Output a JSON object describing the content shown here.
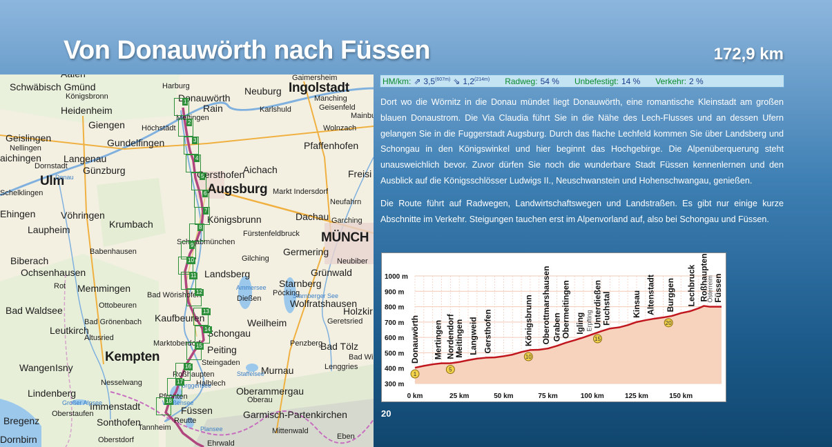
{
  "header": {
    "title": "Von Donauwörth nach Füssen",
    "distance": "172,9 km"
  },
  "infobar": {
    "hm_label": "HM/km:",
    "up_value": "3,5",
    "up_total": "(607m)",
    "down_value": "1,2",
    "down_total": "(214m)",
    "radweg_label": "Radweg:",
    "radweg_value": "54 %",
    "unbefestigt_label": "Unbefestigt:",
    "unbefestigt_value": "14 %",
    "verkehr_label": "Verkehr:",
    "verkehr_value": "2 %"
  },
  "text": {
    "paragraph1": "Dort wo die Wörnitz in die Donau mündet liegt Donauwörth, eine romantische Kleinstadt am großen blauen Donaustrom. Die Via Claudia führt Sie in die Nähe des Lech-Flusses und an dessen Ufern gelangen Sie in die Fuggerstadt Augsburg. Durch das flache Lechfeld kommen Sie über Landsberg und Schongau in den Königswinkel und hier beginnt das Hochgebirge. Die Alpenüberquerung steht unausweichlich bevor. Zuvor dürfen Sie noch die wunderbare Stadt Füssen kennenlernen und den Ausblick auf die Königsschlösser Ludwigs II., Neuschwanstein und Hohenschwangau, genießen.",
    "paragraph2": "Die Route führt auf Radwegen, Landwirtschaftswegen und Landstraßen. Es gibt nur einige kurze Abschnitte im Verkehr. Steigungen tauchen erst im Alpenvorland auf, also bei Schongau und Füssen."
  },
  "page_number": "20",
  "map": {
    "places": [
      {
        "name": "Aalen",
        "cls": "p-mid"
      },
      {
        "name": "Schwäbisch Gmünd",
        "cls": "p-mid"
      },
      {
        "name": "Königsbronn",
        "cls": "p-sm"
      },
      {
        "name": "Heidenheim",
        "cls": "p-mid"
      },
      {
        "name": "Giengen",
        "cls": "p-mid"
      },
      {
        "name": "Höchstädt",
        "cls": "p-sm"
      },
      {
        "name": "Geislingen",
        "cls": "p-mid"
      },
      {
        "name": "Nellingen",
        "cls": "p-sm"
      },
      {
        "name": "aichingen",
        "cls": "p-mid"
      },
      {
        "name": "Gundelfingen",
        "cls": "p-mid"
      },
      {
        "name": "Langenau",
        "cls": "p-mid"
      },
      {
        "name": "Günzburg",
        "cls": "p-mid"
      },
      {
        "name": "Dornstadt",
        "cls": "p-sm"
      },
      {
        "name": "Ulm",
        "cls": "p-big"
      },
      {
        "name": "Schelklingen",
        "cls": "p-sm"
      },
      {
        "name": "Ehingen",
        "cls": "p-mid"
      },
      {
        "name": "Vöhringen",
        "cls": "p-mid"
      },
      {
        "name": "Laupheim",
        "cls": "p-mid"
      },
      {
        "name": "Krumbach",
        "cls": "p-mid"
      },
      {
        "name": "Babenhausen",
        "cls": "p-sm"
      },
      {
        "name": "Biberach",
        "cls": "p-mid"
      },
      {
        "name": "Ochsenhausen",
        "cls": "p-mid"
      },
      {
        "name": "Rot",
        "cls": "p-sm"
      },
      {
        "name": "Memmingen",
        "cls": "p-mid"
      },
      {
        "name": "Ottobeuren",
        "cls": "p-sm"
      },
      {
        "name": "Bad Waldsee",
        "cls": "p-mid"
      },
      {
        "name": "Bad Grönenbach",
        "cls": "p-sm"
      },
      {
        "name": "Leutkirch",
        "cls": "p-mid"
      },
      {
        "name": "Altusried",
        "cls": "p-sm"
      },
      {
        "name": "Kempten",
        "cls": "p-big"
      },
      {
        "name": "Wangen",
        "cls": "p-mid"
      },
      {
        "name": "Isny",
        "cls": "p-mid"
      },
      {
        "name": "Nesselwang",
        "cls": "p-sm"
      },
      {
        "name": "Lindenberg",
        "cls": "p-mid"
      },
      {
        "name": "Immenstadt",
        "cls": "p-mid"
      },
      {
        "name": "Oberstaufen",
        "cls": "p-sm"
      },
      {
        "name": "Sonthofen",
        "cls": "p-mid"
      },
      {
        "name": "Bregenz",
        "cls": "p-mid"
      },
      {
        "name": "Oberstdorf",
        "cls": "p-sm"
      },
      {
        "name": "Dornbirn",
        "cls": "p-mid"
      },
      {
        "name": "Harburg",
        "cls": "p-sm"
      },
      {
        "name": "Donauwörth",
        "cls": "p-mid"
      },
      {
        "name": "Rain",
        "cls": "p-mid"
      },
      {
        "name": "Meitingen",
        "cls": "p-sm"
      },
      {
        "name": "Gersthofen",
        "cls": "p-mid"
      },
      {
        "name": "Augsburg",
        "cls": "p-big"
      },
      {
        "name": "Königsbrunn",
        "cls": "p-mid"
      },
      {
        "name": "Schwabmünchen",
        "cls": "p-sm"
      },
      {
        "name": "Landsberg",
        "cls": "p-mid"
      },
      {
        "name": "Bad Wörishofen",
        "cls": "p-sm"
      },
      {
        "name": "Kaufbeuren",
        "cls": "p-mid"
      },
      {
        "name": "Marktoberdorf",
        "cls": "p-sm"
      },
      {
        "name": "Schongau",
        "cls": "p-mid"
      },
      {
        "name": "Peiting",
        "cls": "p-mid"
      },
      {
        "name": "Steingaden",
        "cls": "p-sm"
      },
      {
        "name": "Roßhaupten",
        "cls": "p-sm"
      },
      {
        "name": "Halblech",
        "cls": "p-sm"
      },
      {
        "name": "Füssen",
        "cls": "p-mid"
      },
      {
        "name": "Reutte",
        "cls": "p-sm"
      },
      {
        "name": "Pfronten",
        "cls": "p-sm"
      },
      {
        "name": "Neuburg",
        "cls": "p-mid"
      },
      {
        "name": "Ingolstadt",
        "cls": "p-big"
      },
      {
        "name": "Gaimersheim",
        "cls": "p-sm"
      },
      {
        "name": "Manching",
        "cls": "p-sm"
      },
      {
        "name": "Geisenfeld",
        "cls": "p-sm"
      },
      {
        "name": "Karlshuld",
        "cls": "p-sm"
      },
      {
        "name": "Mainbu",
        "cls": "p-sm"
      },
      {
        "name": "Wolnzach",
        "cls": "p-sm"
      },
      {
        "name": "Pfaffenhofen",
        "cls": "p-mid"
      },
      {
        "name": "Aichach",
        "cls": "p-mid"
      },
      {
        "name": "Freisi",
        "cls": "p-mid"
      },
      {
        "name": "Markt Indersdorf",
        "cls": "p-sm"
      },
      {
        "name": "Neufahrn",
        "cls": "p-sm"
      },
      {
        "name": "Dachau",
        "cls": "p-mid"
      },
      {
        "name": "Garching",
        "cls": "p-sm"
      },
      {
        "name": "Fürstenfeldbruck",
        "cls": "p-sm"
      },
      {
        "name": "MÜNCH",
        "cls": "p-big"
      },
      {
        "name": "Germering",
        "cls": "p-mid"
      },
      {
        "name": "Neubiber",
        "cls": "p-sm"
      },
      {
        "name": "Gilching",
        "cls": "p-sm"
      },
      {
        "name": "Grünwald",
        "cls": "p-mid"
      },
      {
        "name": "Starnberg",
        "cls": "p-mid"
      },
      {
        "name": "Wolfratshausen",
        "cls": "p-mid"
      },
      {
        "name": "Dießen",
        "cls": "p-sm"
      },
      {
        "name": "Pöcking",
        "cls": "p-sm"
      },
      {
        "name": "Holzkir",
        "cls": "p-mid"
      },
      {
        "name": "Weilheim",
        "cls": "p-mid"
      },
      {
        "name": "Geretsried",
        "cls": "p-sm"
      },
      {
        "name": "Penzberg",
        "cls": "p-sm"
      },
      {
        "name": "Bad Tölz",
        "cls": "p-mid"
      },
      {
        "name": "Bad Wi",
        "cls": "p-sm"
      },
      {
        "name": "Lenggries",
        "cls": "p-sm"
      },
      {
        "name": "Murnau",
        "cls": "p-mid"
      },
      {
        "name": "Oberammergau",
        "cls": "p-mid"
      },
      {
        "name": "Oberau",
        "cls": "p-sm"
      },
      {
        "name": "Garmisch-Partenkirchen",
        "cls": "p-mid"
      },
      {
        "name": "Mittenwald",
        "cls": "p-sm"
      },
      {
        "name": "Eben",
        "cls": "p-sm"
      },
      {
        "name": "Ehrwald",
        "cls": "p-sm"
      },
      {
        "name": "Tannheim",
        "cls": "p-sm"
      },
      {
        "name": "Ammersee",
        "cls": "p-lake"
      },
      {
        "name": "Starnberger See",
        "cls": "p-lake"
      },
      {
        "name": "Staffelsee",
        "cls": "p-lake"
      },
      {
        "name": "Forggensee",
        "cls": "p-lake"
      },
      {
        "name": "Weißensee",
        "cls": "p-lake"
      },
      {
        "name": "Plansee",
        "cls": "p-lake"
      },
      {
        "name": "Großer Alpsee",
        "cls": "p-lake"
      },
      {
        "name": "Donau",
        "cls": "p-lake"
      }
    ],
    "route_stages": [
      "1",
      "2",
      "3",
      "4",
      "5",
      "6",
      "7",
      "8",
      "9",
      "10",
      "11",
      "12",
      "13",
      "14",
      "15",
      "16",
      "17",
      "18"
    ]
  },
  "profile": {
    "y_ticks": [
      "1000 m",
      "900 m",
      "800 m",
      "700 m",
      "600 m",
      "500 m",
      "400 m",
      "300 m"
    ],
    "x_ticks": [
      "0 km",
      "25 km",
      "50 km",
      "75 km",
      "100 km",
      "125 km",
      "150 km"
    ],
    "markers": [
      "1",
      "5",
      "10",
      "15",
      "20"
    ],
    "places": [
      {
        "name": "Donauwörth",
        "km": 0,
        "small": false
      },
      {
        "name": "Mertingen",
        "km": 13,
        "small": false
      },
      {
        "name": "Nordendorf",
        "km": 20,
        "small": false
      },
      {
        "name": "Meitingen",
        "km": 25,
        "small": false
      },
      {
        "name": "Langweid",
        "km": 33,
        "small": false
      },
      {
        "name": "Gersthofen",
        "km": 41,
        "small": false
      },
      {
        "name": "Königsbrunn",
        "km": 64,
        "small": false
      },
      {
        "name": "Oberottmarshausen",
        "km": 74,
        "small": false
      },
      {
        "name": "Graben",
        "km": 80,
        "small": false
      },
      {
        "name": "Obermeitingen",
        "km": 85,
        "small": false
      },
      {
        "name": "Igling",
        "km": 93,
        "small": false
      },
      {
        "name": "Erpfting",
        "km": 98,
        "small": true
      },
      {
        "name": "Unterdießen",
        "km": 103,
        "small": false
      },
      {
        "name": "Fuchstal",
        "km": 108,
        "small": false
      },
      {
        "name": "Kinsau",
        "km": 125,
        "small": false
      },
      {
        "name": "Altenstadt",
        "km": 133,
        "small": false
      },
      {
        "name": "Burggen",
        "km": 144,
        "small": false
      },
      {
        "name": "Lechbruck",
        "km": 156,
        "small": false
      },
      {
        "name": "Roßhaupten",
        "km": 163,
        "small": false
      },
      {
        "name": "Österreim",
        "km": 166,
        "small": true
      },
      {
        "name": "Füssen",
        "km": 171,
        "small": false
      }
    ]
  },
  "chart_data": {
    "type": "area",
    "title": "",
    "xlabel": "",
    "ylabel": "",
    "xlim": [
      0,
      172.9
    ],
    "ylim": [
      300,
      1000
    ],
    "x": [
      0,
      5,
      10,
      15,
      20,
      25,
      30,
      35,
      40,
      45,
      50,
      55,
      60,
      65,
      70,
      75,
      80,
      85,
      90,
      95,
      100,
      105,
      110,
      115,
      120,
      125,
      130,
      135,
      140,
      145,
      150,
      155,
      160,
      163,
      166,
      170,
      172.9
    ],
    "series": [
      {
        "values": [
          403,
          415,
          425,
          432,
          432,
          440,
          452,
          462,
          468,
          470,
          478,
          488,
          505,
          518,
          520,
          528,
          545,
          565,
          582,
          600,
          620,
          640,
          658,
          665,
          680,
          700,
          712,
          722,
          730,
          740,
          758,
          770,
          790,
          805,
          800,
          800,
          800
        ]
      }
    ],
    "colors": {
      "line": "#c0171e",
      "fill": "#f7d3bd",
      "grid": "#f3c9b7",
      "marker": "#f2d24a"
    }
  }
}
